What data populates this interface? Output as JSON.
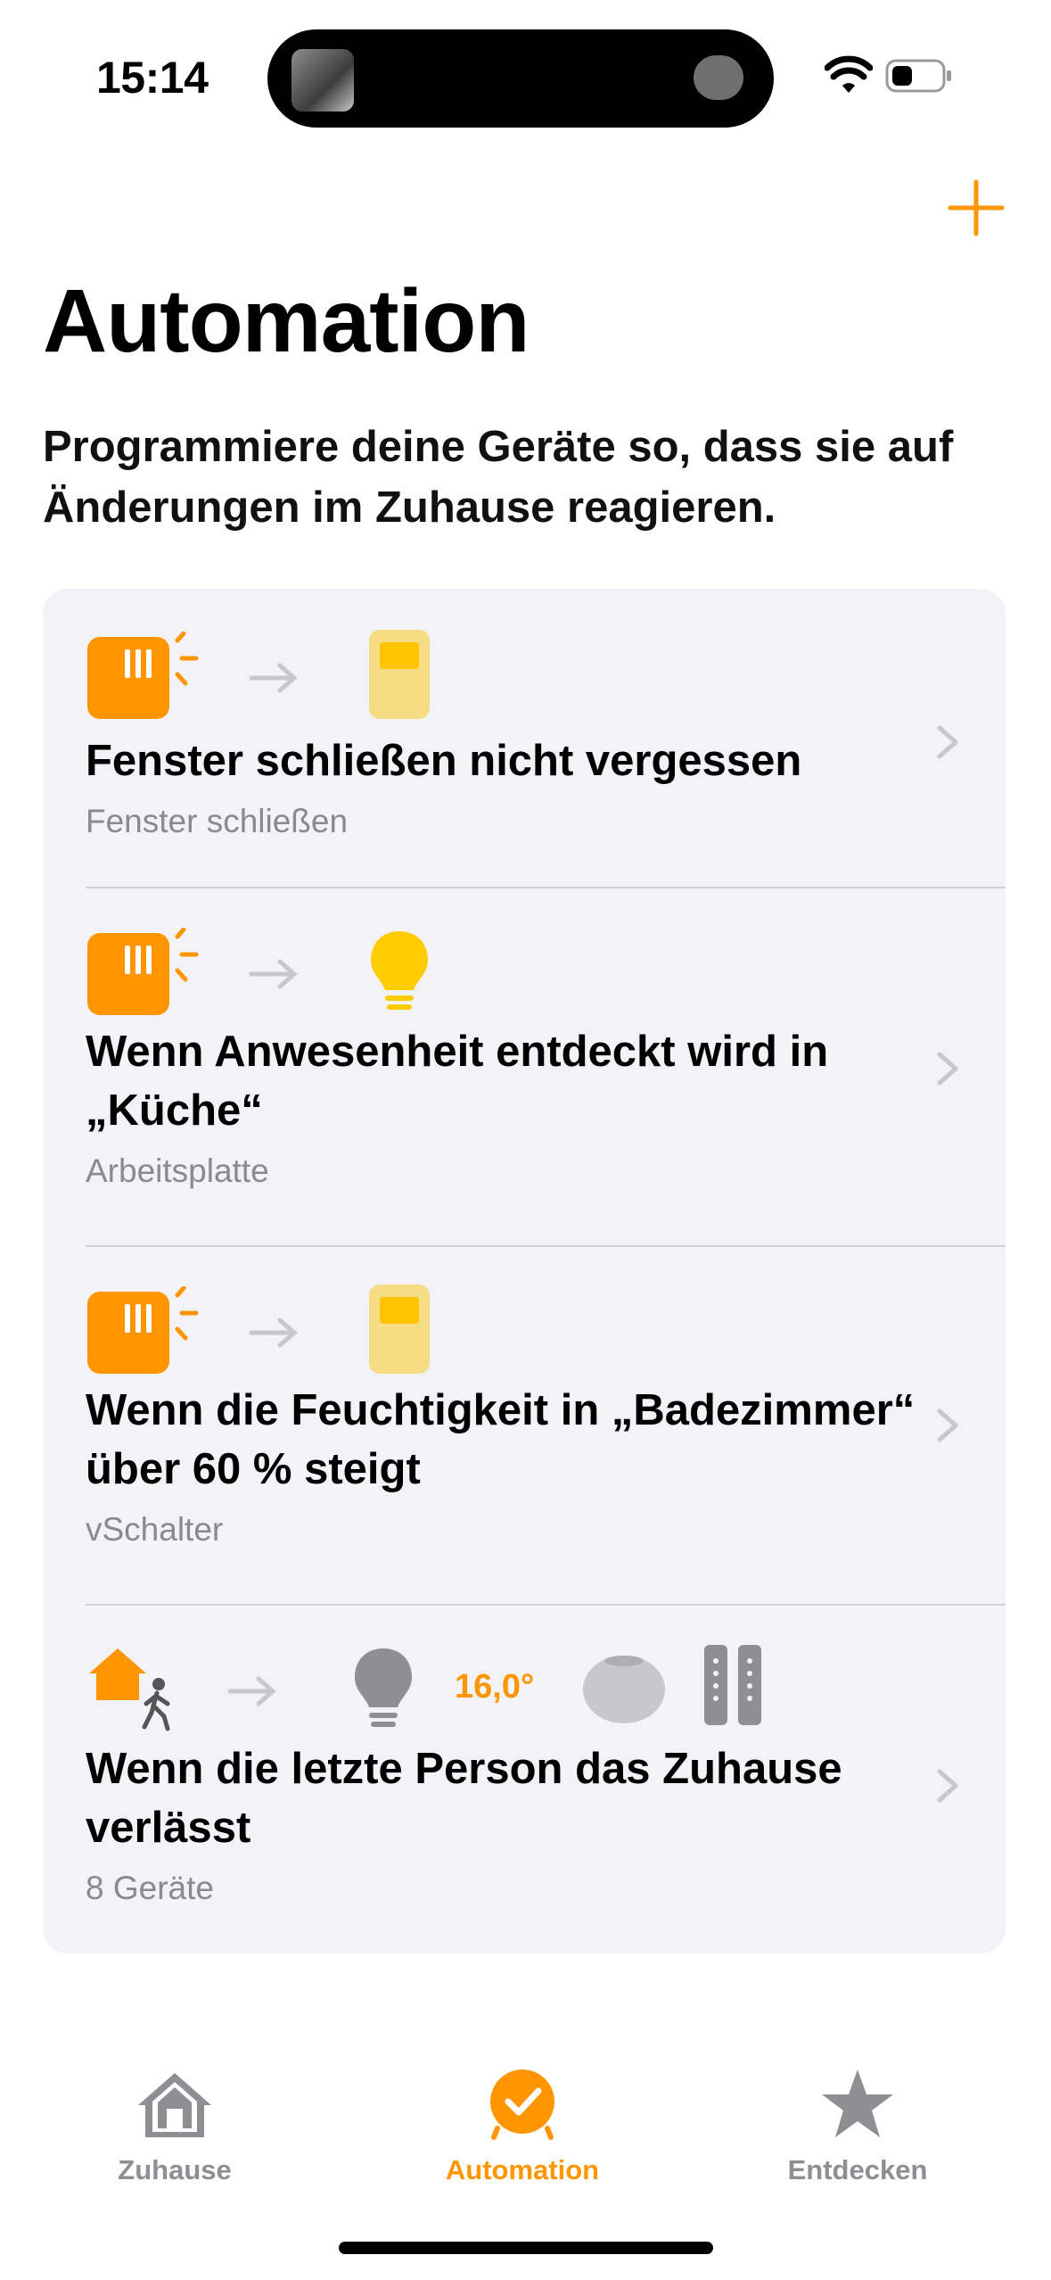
{
  "status_bar": {
    "time": "15:14"
  },
  "header": {
    "add_icon": "plus-icon",
    "title": "Automation",
    "subtitle": "Programmiere deine Geräte so, dass sie auf Änderungen im Zuhause reagieren."
  },
  "automations": [
    {
      "title": "Fenster schließen nicht vergessen",
      "subtitle": "Fenster schließen",
      "icons": [
        "sensor-icon",
        "arrow-icon",
        "switch-icon"
      ]
    },
    {
      "title": "Wenn Anwesenheit entdeckt wird in „Küche“",
      "subtitle": "Arbeitsplatte",
      "icons": [
        "sensor-icon",
        "arrow-icon",
        "lightbulb-icon"
      ]
    },
    {
      "title": "Wenn die Feuchtigkeit in „Badezimmer“ über 60 % steigt",
      "subtitle": "vSchalter",
      "icons": [
        "sensor-icon",
        "arrow-icon",
        "switch-icon"
      ]
    },
    {
      "title": "Wenn die letzte Person das Zuhause verlässt",
      "subtitle": "8 Geräte",
      "temperature": "16,0°",
      "icons": [
        "home-leave-icon",
        "arrow-icon",
        "lightbulb-icon",
        "homepod-icon",
        "power-strip-icon"
      ]
    }
  ],
  "tabs": [
    {
      "label": "Zuhause",
      "icon": "house-icon",
      "active": false
    },
    {
      "label": "Automation",
      "icon": "automation-clock-icon",
      "active": true
    },
    {
      "label": "Entdecken",
      "icon": "star-icon",
      "active": false
    }
  ],
  "colors": {
    "accent": "#FF9500",
    "inactive": "#8A8A8E",
    "card": "#F2F2F7"
  }
}
